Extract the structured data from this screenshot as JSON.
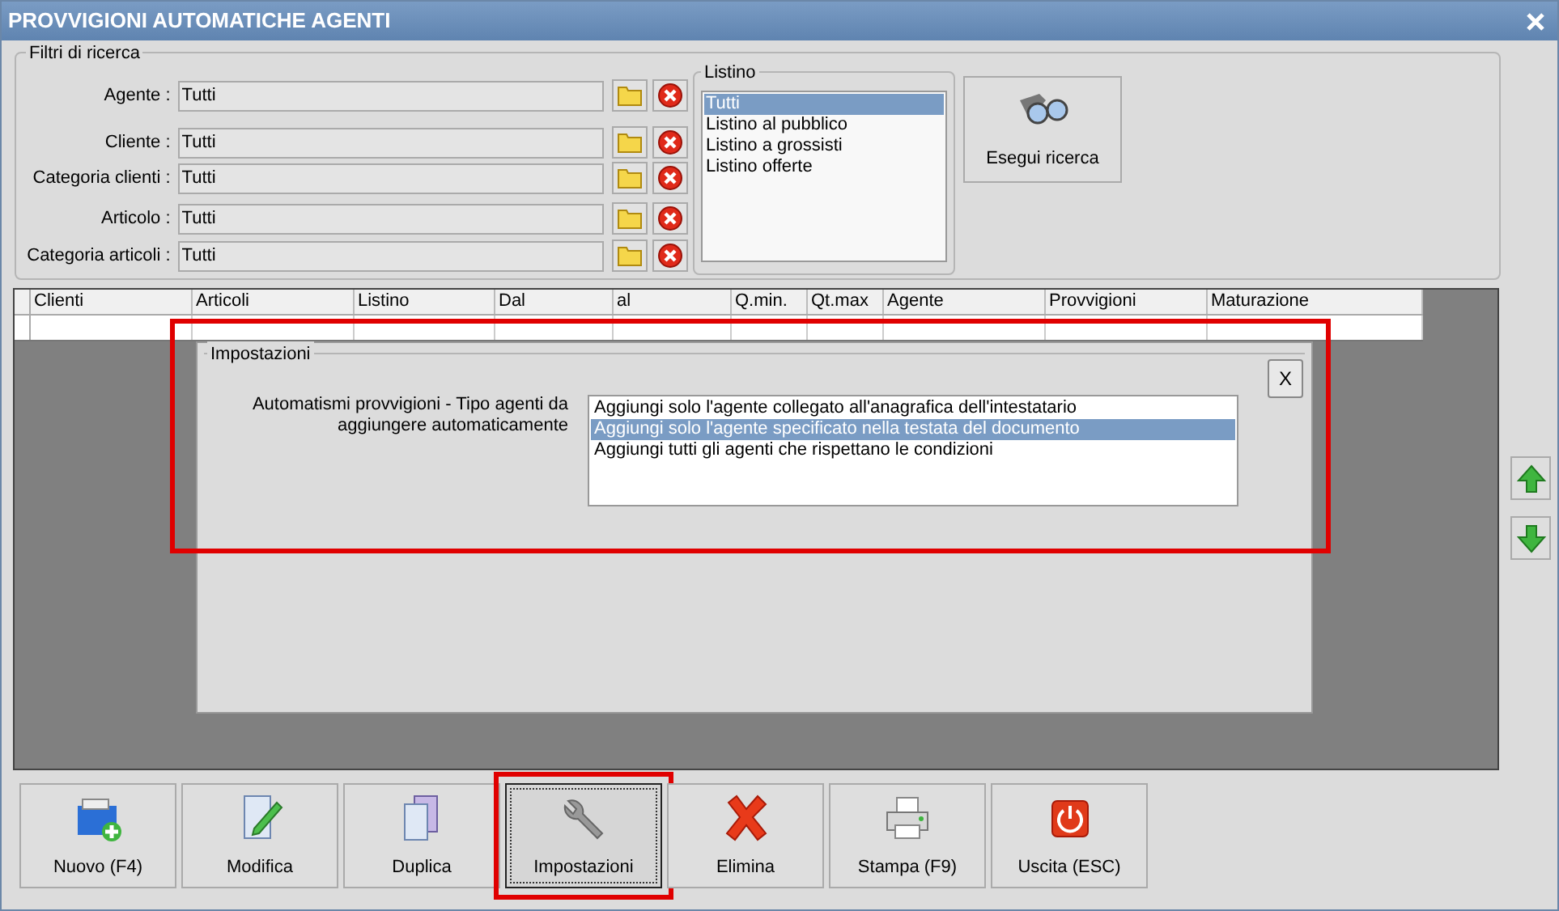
{
  "window": {
    "title": "PROVVIGIONI AUTOMATICHE AGENTI"
  },
  "filters": {
    "title": "Filtri di ricerca",
    "fields": [
      {
        "label": "Agente :",
        "value": "Tutti"
      },
      {
        "label": "Cliente :",
        "value": "Tutti"
      },
      {
        "label": "Categoria clienti :",
        "value": "Tutti"
      },
      {
        "label": "Articolo :",
        "value": "Tutti"
      },
      {
        "label": "Categoria articoli :",
        "value": "Tutti"
      }
    ],
    "listino": {
      "title": "Listino",
      "items": [
        {
          "label": "Tutti",
          "selected": true
        },
        {
          "label": "Listino al pubblico",
          "selected": false
        },
        {
          "label": "Listino a grossisti",
          "selected": false
        },
        {
          "label": "Listino offerte",
          "selected": false
        }
      ]
    },
    "search_button": "Esegui ricerca"
  },
  "table": {
    "columns": [
      "Clienti",
      "Articoli",
      "Listino",
      "Dal",
      "al",
      "Q.min.",
      "Qt.max",
      "Agente",
      "Provvigioni",
      "Maturazione"
    ]
  },
  "settings_panel": {
    "title": "Impostazioni",
    "close": "X",
    "highlighted": true,
    "label": "Automatismi provvigioni - Tipo agenti da aggiungere automaticamente",
    "options": [
      {
        "label": "Aggiungi solo l'agente collegato all'anagrafica dell'intestatario",
        "selected": false
      },
      {
        "label": "Aggiungi solo l'agente specificato nella testata del documento",
        "selected": true
      },
      {
        "label": "Aggiungi tutti gli agenti che rispettano le condizioni",
        "selected": false
      }
    ]
  },
  "toolbar": [
    {
      "kind": "new",
      "label": "Nuovo (F4)",
      "selected": false,
      "highlighted": false
    },
    {
      "kind": "edit",
      "label": "Modifica",
      "selected": false,
      "highlighted": false
    },
    {
      "kind": "duplicate",
      "label": "Duplica",
      "selected": false,
      "highlighted": false
    },
    {
      "kind": "settings",
      "label": "Impostazioni",
      "selected": true,
      "highlighted": true
    },
    {
      "kind": "delete",
      "label": "Elimina",
      "selected": false,
      "highlighted": false
    },
    {
      "kind": "print",
      "label": "Stampa (F9)",
      "selected": false,
      "highlighted": false
    },
    {
      "kind": "exit",
      "label": "Uscita (ESC)",
      "selected": false,
      "highlighted": false
    }
  ]
}
